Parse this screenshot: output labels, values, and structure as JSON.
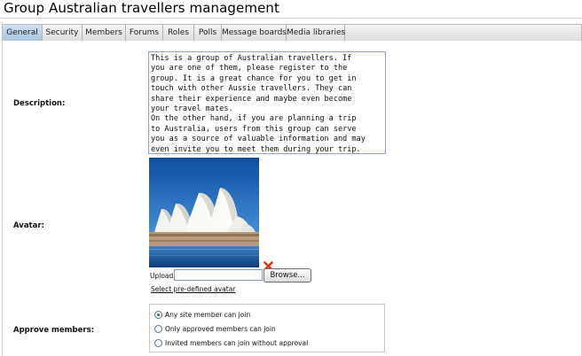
{
  "page": {
    "title": "Group Australian travellers management"
  },
  "tabs": [
    {
      "label": "General",
      "active": true
    },
    {
      "label": "Security",
      "active": false
    },
    {
      "label": "Members",
      "active": false
    },
    {
      "label": "Forums",
      "active": false
    },
    {
      "label": "Roles",
      "active": false
    },
    {
      "label": "Polls",
      "active": false
    },
    {
      "label": "Message boards",
      "active": false
    },
    {
      "label": "Media libraries",
      "active": false
    }
  ],
  "form": {
    "description_label": "Description:",
    "description_value": "This is a group of Australian travellers. If\nyou are one of them, please register to the\ngroup. It is a great chance for you to get in\ntouch with other Aussie travellers. They can\nshare their experience and maybe even become\nyour travel mates.\nOn the other hand, if you are planning a trip\nto Australia, users from this group can serve\nyou as a source of valuable information and may\neven invite you to meet them during your trip.",
    "avatar_label": "Avatar:",
    "upload_label": "Upload:",
    "upload_value": "",
    "browse_label": "Browse...",
    "predefined_avatar_link": "Select pre-defined avatar",
    "approve_label": "Approve members:",
    "approve_options": [
      {
        "label": "Any site member can join",
        "checked": true
      },
      {
        "label": "Only approved members can join",
        "checked": false
      },
      {
        "label": "Invited members can join without approval",
        "checked": false
      }
    ]
  },
  "icons": {
    "avatar": "sydney-opera-house-photo",
    "delete": "red-x-delete-icon"
  },
  "colors": {
    "active_tab": "#bcd3ea",
    "link_text": "#111111",
    "delete_icon": "#d9361c",
    "radio_selected": "#1f8a1f"
  }
}
